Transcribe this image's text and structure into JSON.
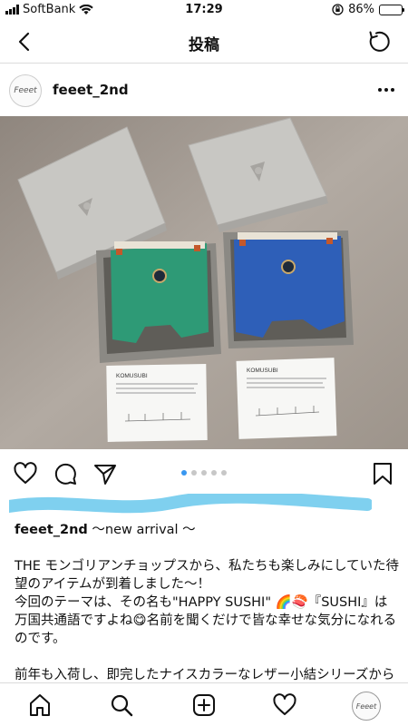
{
  "status_bar": {
    "carrier": "SoftBank",
    "time": "17:29",
    "battery_percent": "86%",
    "battery_level": 0.86,
    "battery_color": "#31c24a"
  },
  "nav": {
    "title": "投稿"
  },
  "post": {
    "username": "feeet_2nd",
    "avatar_text": "Feeet",
    "image_indicator": {
      "total": 5,
      "active": 1,
      "active_color": "#3897f0"
    },
    "photo_cards": {
      "left_title": "KOMUSUBI",
      "right_title": "KOMUSUBI"
    }
  },
  "caption": {
    "username": "feeet_2nd",
    "headline": " 〜new arrival 〜",
    "lines": [
      "THE モンゴリアンチョップスから、私たちも楽しみにしていた待望のアイテムが到着しました〜！",
      "今回のテーマは、その名も\"HAPPY SUSHI\" 🌈🍣『SUSHI』は万国共通語ですよね😋名前を聞くだけで皆な幸せな気分になれるのです。",
      "前年も入荷し、即完したナイスカラーなレザー小結シリーズから今季verが入荷です 🐾"
    ]
  },
  "tabbar": {
    "avatar_text": "Feeet"
  },
  "colors": {
    "divider": "#dbdbdb",
    "scribble": "#7fd0ef",
    "green_bag": "#2e9a76",
    "blue_bag": "#2e5fb8"
  }
}
